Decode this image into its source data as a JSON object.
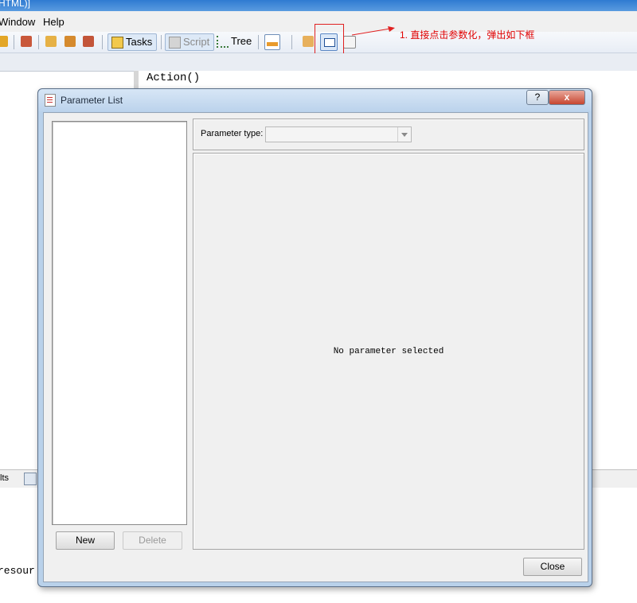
{
  "app": {
    "title_fragment": "HTML)]",
    "menu": {
      "window": "Window",
      "help": "Help"
    },
    "toolbar": {
      "tasks": "Tasks",
      "script": "Script",
      "tree": "Tree"
    },
    "editor_text": "Action()",
    "bottom_tab": "lts",
    "output_text": "resour"
  },
  "annotation": {
    "text": "1. 直接点击参数化，弹出如下框",
    "color": "#e00000"
  },
  "dialog": {
    "title": "Parameter List",
    "help_symbol": "?",
    "close_symbol": "x",
    "buttons": {
      "new": "New",
      "delete": "Delete",
      "close": "Close"
    },
    "parameter_type_label": "Parameter type:",
    "parameter_type_value": "",
    "empty_message": "No parameter selected"
  },
  "colors": {
    "accent": "#5a9be0",
    "dialog_frame": "#b9d1ea",
    "close_button": "#c7452f"
  }
}
